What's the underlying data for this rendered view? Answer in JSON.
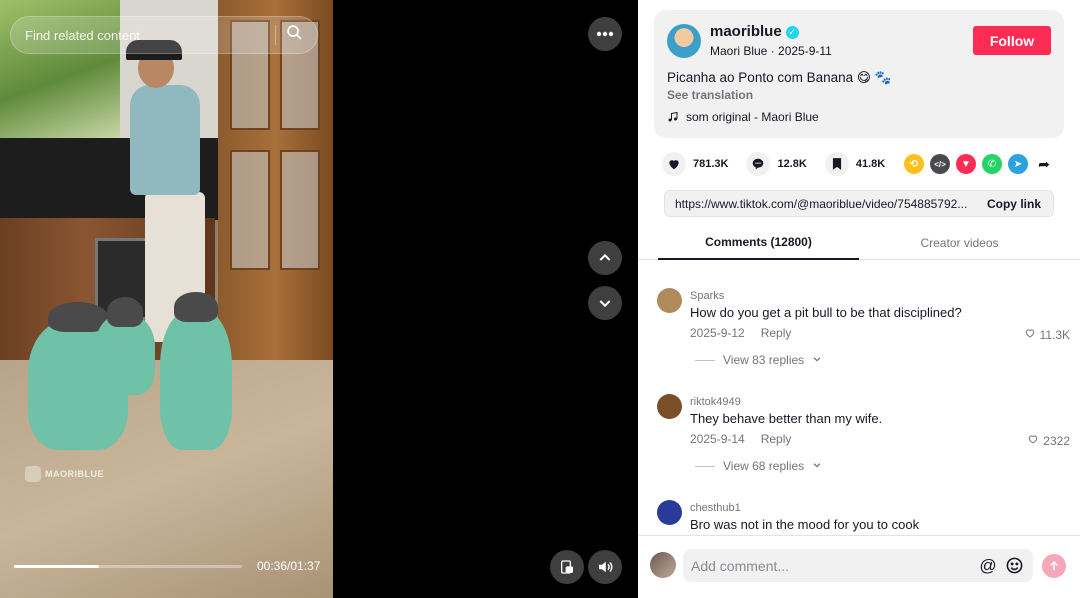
{
  "video": {
    "search_placeholder": "Find related content",
    "watermark": "MAORIBLUE",
    "time": "00:36/01:37",
    "progress_fraction": 0.371
  },
  "author": {
    "username": "maoriblue",
    "verified": true,
    "display_name_date": "Maori Blue · 2025-9-11",
    "follow_label": "Follow"
  },
  "post": {
    "caption": "Picanha ao Ponto com Banana 😋 🐾",
    "see_translation": "See translation",
    "music": "som original - Maori Blue"
  },
  "stats": {
    "likes": "781.3K",
    "comments": "12.8K",
    "saves": "41.8K"
  },
  "share": {
    "icons": [
      "repost-icon",
      "embed-icon",
      "send-icon",
      "whatsapp-icon",
      "telegram-icon",
      "share-arrow-icon"
    ],
    "colors": [
      "#fcc11f",
      "#4a4a4e",
      "#fe2c55",
      "#25d366",
      "#2aa3e0",
      "#161823"
    ]
  },
  "link": {
    "url": "https://www.tiktok.com/@maoriblue/video/754885792...",
    "copy_label": "Copy link"
  },
  "tabs": [
    {
      "label": "Comments (12800)",
      "active": true
    },
    {
      "label": "Creator videos",
      "active": false
    }
  ],
  "comments": [
    {
      "user": "Sparks",
      "text": "How do you get a pit bull to be that disciplined?",
      "date": "2025-9-12",
      "reply": "Reply",
      "likes": "11.3K",
      "replies": "View 83 replies",
      "avatar_color": "#b08a5a"
    },
    {
      "user": "riktok4949",
      "text": "They behave better than my wife.",
      "date": "2025-9-14",
      "reply": "Reply",
      "likes": "2322",
      "replies": "View 68 replies",
      "avatar_color": "#7a4e28"
    },
    {
      "user": "chesthub1",
      "text": "Bro was not in the mood for you to cook",
      "date": "",
      "reply": "",
      "likes": "",
      "replies": "",
      "avatar_color": "#2a3a9a"
    }
  ],
  "comment_bar": {
    "placeholder": "Add comment..."
  }
}
